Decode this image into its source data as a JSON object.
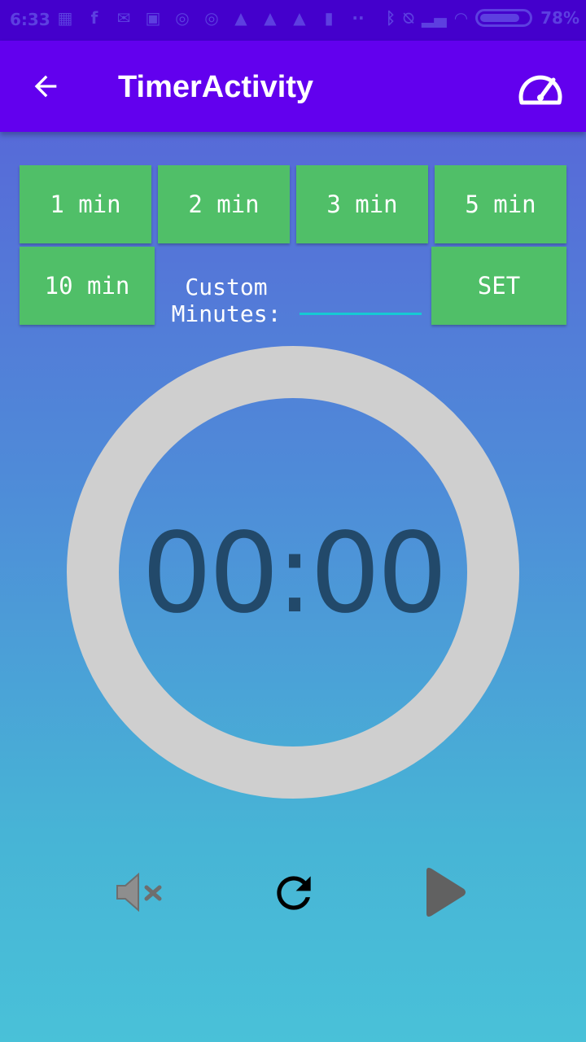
{
  "status_bar": {
    "time": "6:33",
    "battery": "78%"
  },
  "app_bar": {
    "title": "TimerActivity",
    "back_icon": "arrow-back-icon",
    "speed_icon": "speedometer-icon"
  },
  "presets": [
    {
      "label": "1 min"
    },
    {
      "label": "2 min"
    },
    {
      "label": "3 min"
    },
    {
      "label": "5 min"
    },
    {
      "label": "10 min"
    }
  ],
  "custom": {
    "label_line1": "Custom",
    "label_line2": "Minutes:",
    "value": "",
    "set_label": "SET"
  },
  "timer": {
    "display": "00:00"
  },
  "controls": {
    "mute_icon": "volume-mute-icon",
    "reset_icon": "refresh-icon",
    "play_icon": "play-icon"
  },
  "colors": {
    "app_bar": "#6200ee",
    "button": "#50bf68",
    "ring": "#cfcfcf",
    "timer_text": "#22496a",
    "input_underline": "#16c9d3"
  }
}
